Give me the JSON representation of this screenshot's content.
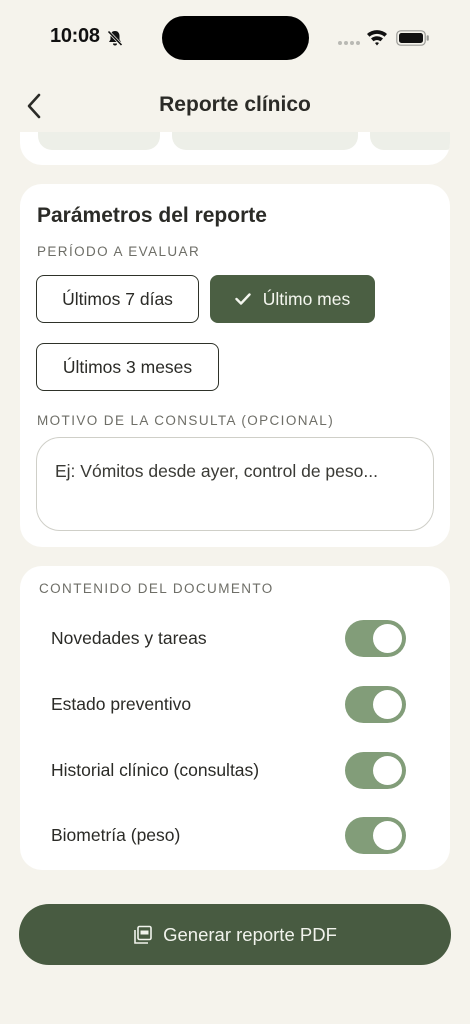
{
  "status_bar": {
    "time": "10:08"
  },
  "header": {
    "title": "Reporte clínico"
  },
  "params_card": {
    "title": "Parámetros del reporte",
    "period_label": "PERÍODO A EVALUAR",
    "period_options": [
      {
        "label": "Últimos 7 días",
        "selected": false
      },
      {
        "label": "Último mes",
        "selected": true
      },
      {
        "label": "Últimos 3 meses",
        "selected": false
      }
    ],
    "reason_label": "MOTIVO DE LA CONSULTA (OPCIONAL)",
    "reason_placeholder": "Ej: Vómitos desde ayer, control de peso..."
  },
  "content_card": {
    "label": "CONTENIDO DEL DOCUMENTO",
    "toggles": [
      {
        "label": "Novedades y tareas",
        "on": true
      },
      {
        "label": "Estado preventivo",
        "on": true
      },
      {
        "label": "Historial clínico (consultas)",
        "on": true
      },
      {
        "label": "Biometría (peso)",
        "on": true
      }
    ]
  },
  "actions": {
    "generate_label": "Generar reporte PDF"
  },
  "colors": {
    "background": "#F5F3EC",
    "primary": "#485B41",
    "toggle_on": "#829D79"
  }
}
